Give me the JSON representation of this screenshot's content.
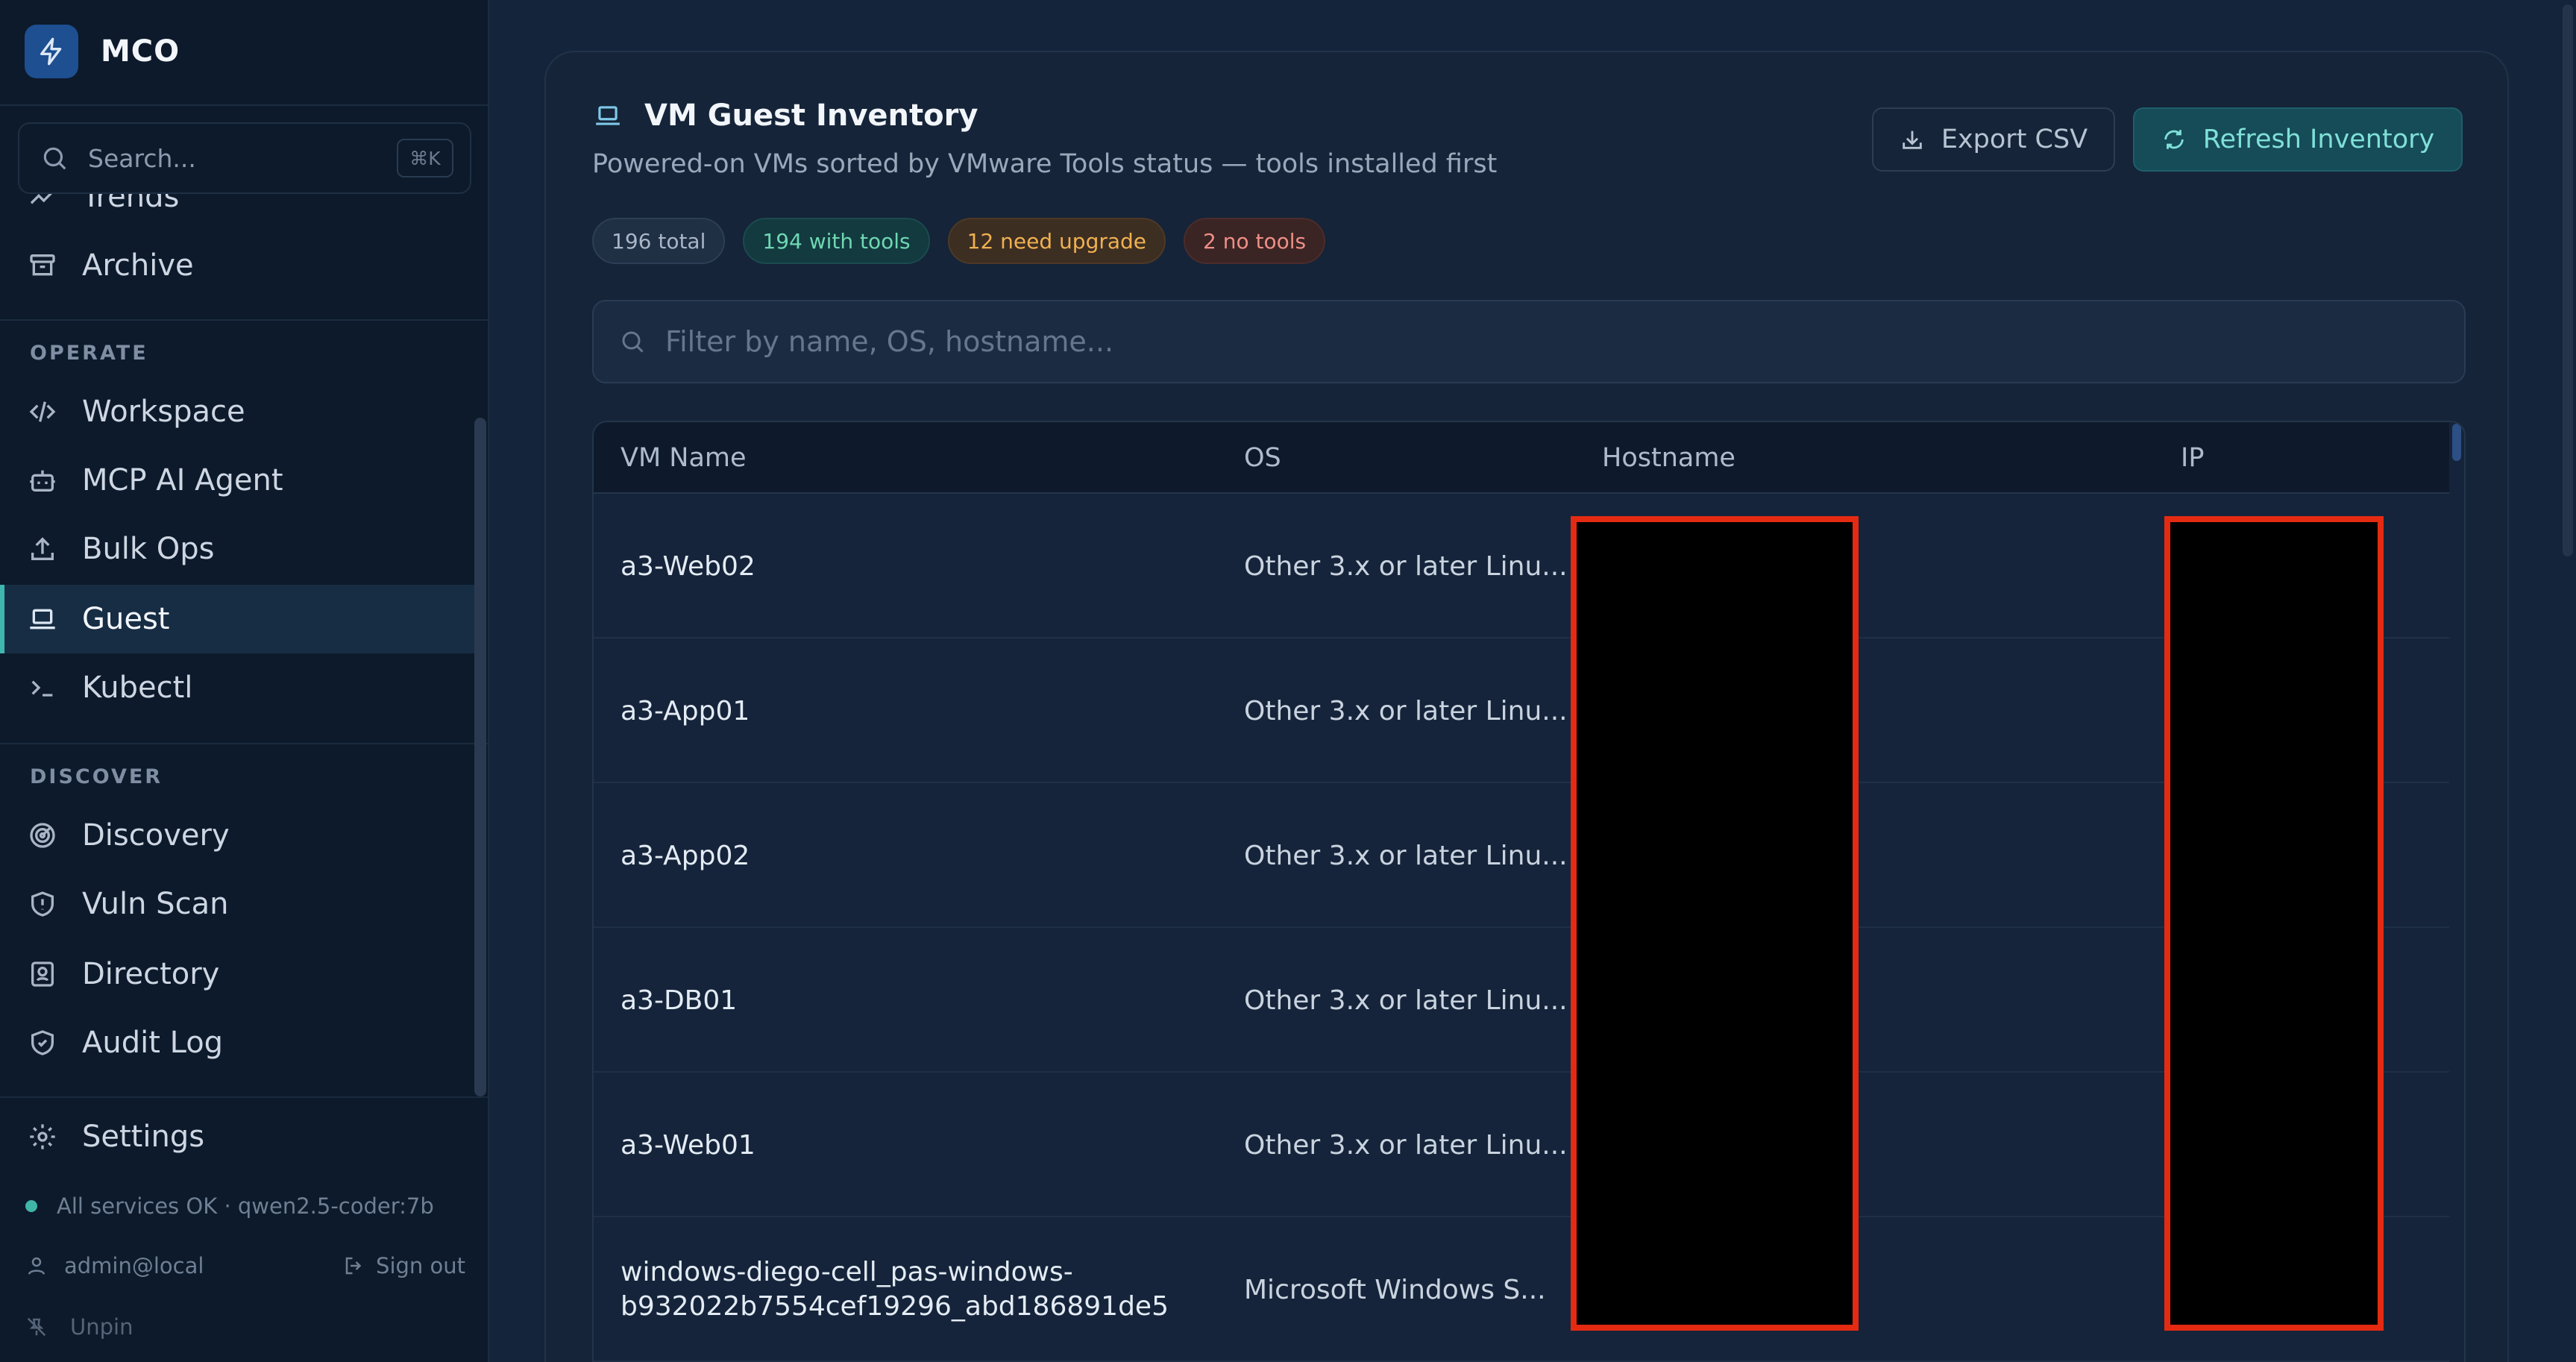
{
  "sidebar": {
    "brand": "MCO",
    "search": {
      "placeholder": "Search...",
      "shortcut": "⌘K"
    },
    "top_items": [
      {
        "label": "Trends",
        "icon": "trend-icon"
      },
      {
        "label": "Archive",
        "icon": "archive-icon"
      }
    ],
    "sections": [
      {
        "title": "OPERATE",
        "items": [
          {
            "label": "Workspace",
            "icon": "code-icon"
          },
          {
            "label": "MCP AI Agent",
            "icon": "bot-icon"
          },
          {
            "label": "Bulk Ops",
            "icon": "upload-icon"
          },
          {
            "label": "Guest",
            "icon": "laptop-icon",
            "active": true
          },
          {
            "label": "Kubectl",
            "icon": "terminal-icon"
          }
        ]
      },
      {
        "title": "DISCOVER",
        "items": [
          {
            "label": "Discovery",
            "icon": "radar-icon"
          },
          {
            "label": "Vuln Scan",
            "icon": "shield-alert-icon"
          },
          {
            "label": "Directory",
            "icon": "contact-icon"
          },
          {
            "label": "Audit Log",
            "icon": "shield-check-icon"
          }
        ]
      }
    ],
    "settings": "Settings",
    "status": "All services OK · qwen2.5-coder:7b",
    "user": "admin@local",
    "sign_out": "Sign out",
    "unpin": "Unpin"
  },
  "inventory": {
    "title": "VM Guest Inventory",
    "subtitle": "Powered-on VMs sorted by VMware Tools status — tools installed first",
    "export_label": "Export CSV",
    "refresh_label": "Refresh Inventory",
    "badges": {
      "total": "196 total",
      "with_tools": "194 with tools",
      "need_upgrade": "12 need upgrade",
      "no_tools": "2 no tools"
    },
    "filter_placeholder": "Filter by name, OS, hostname...",
    "columns": [
      "VM Name",
      "OS",
      "Hostname",
      "IP"
    ],
    "rows": [
      {
        "name": "a3-Web02",
        "os": "Other 3.x or later Linu..."
      },
      {
        "name": "a3-App01",
        "os": "Other 3.x or later Linu..."
      },
      {
        "name": "a3-App02",
        "os": "Other 3.x or later Linu..."
      },
      {
        "name": "a3-DB01",
        "os": "Other 3.x or later Linu..."
      },
      {
        "name": "a3-Web01",
        "os": "Other 3.x or later Linu..."
      },
      {
        "name_line1": "windows-diego-cell_pas-windows-",
        "name_line2": "b932022b7554cef19296_abd186891de5",
        "os": "Microsoft Windows S..."
      }
    ]
  },
  "colors": {
    "accent": "#3fb6b0",
    "background": "#14243a",
    "sidebar": "#0d1a2b",
    "redaction_border": "#e52a12"
  }
}
